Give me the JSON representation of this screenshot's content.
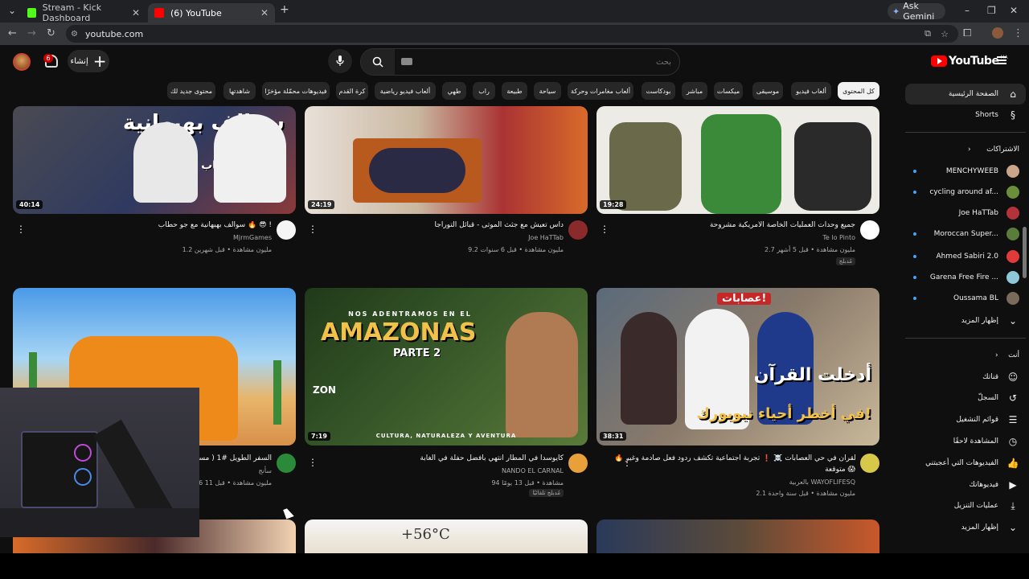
{
  "browser": {
    "tabs": [
      {
        "label": "Stream - Kick Dashboard",
        "favicon_color": "#53fc18"
      },
      {
        "label": "(6) YouTube",
        "favicon_color": "#ff0000"
      }
    ],
    "gemini_label": "Ask Gemini",
    "url": "youtube.com"
  },
  "header": {
    "notification_count": "6",
    "create_label": "إنشاء",
    "search_placeholder": "بحث",
    "logo_text": "YouTube",
    "logo_region": "MA"
  },
  "chips": [
    {
      "label": "كل المحتوى",
      "active": true
    },
    {
      "label": "ألعاب فيديو"
    },
    {
      "label": "موسيقى"
    },
    {
      "label": "ميكسات"
    },
    {
      "label": "مباشر"
    },
    {
      "label": "بودكاست"
    },
    {
      "label": "ألعاب مغامرات وحركة"
    },
    {
      "label": "سياحة"
    },
    {
      "label": "طبيعة"
    },
    {
      "label": "راب"
    },
    {
      "label": "طهي"
    },
    {
      "label": "ألعاب فيديو رياضية"
    },
    {
      "label": "كرة القدم"
    },
    {
      "label": "فيديوهات محمّلة مؤخرًا"
    },
    {
      "label": "شاهدتها"
    },
    {
      "label": "محتوى جديد لك"
    }
  ],
  "sidebar": {
    "home": "الصفحة الرئيسية",
    "shorts": "Shorts",
    "subscriptions_header": "الاشتراكات",
    "subscriptions": [
      {
        "label": "MENCHYWEEB",
        "color": "#c9a58a"
      },
      {
        "label": "cycling around af...",
        "color": "#6b8e3a"
      },
      {
        "label": "Joe HaTTab",
        "color": "#b4323a"
      },
      {
        "label": "Moroccan Super...",
        "color": "#5a7d3a"
      },
      {
        "label": "Ahmed Sabiri 2.0",
        "color": "#e03a3a"
      },
      {
        "label": "Garena Free Fire ...",
        "color": "#8ec7d8"
      },
      {
        "label": "Oussama BL",
        "color": "#7a6a5a"
      }
    ],
    "show_more": "إظهار المزيد",
    "you_header": "أنت",
    "you_items": [
      {
        "label": "قناتك",
        "icon": "person-icon"
      },
      {
        "label": "السجلّ",
        "icon": "history-icon"
      },
      {
        "label": "قوائم التشغيل",
        "icon": "playlist-icon"
      },
      {
        "label": "المشاهدة لاحقًا",
        "icon": "clock-icon"
      },
      {
        "label": "الفيديوهات التي أعجبتني",
        "icon": "thumbs-up-icon"
      },
      {
        "label": "فيديوهاتك",
        "icon": "video-icon"
      },
      {
        "label": "عمليات التنزيل",
        "icon": "download-icon"
      }
    ],
    "show_more_2": "إظهار المزيد"
  },
  "videos": [
    {
      "duration": "40:14",
      "title": "سوالف بهبهانية مع جو حطاب 🔥 😎 !",
      "channel": "MjrmGames",
      "meta": "1.2 مليون مشاهدة • قبل شهرين",
      "thumb_text": "سوالف بهبهانية",
      "thumb_sub": "مع جو حطاب"
    },
    {
      "duration": "24:19",
      "title": "داس تعيش مع جثث الموتى - قبائل التوراجا",
      "channel": "Joe HaTTab",
      "meta": "9.2 مليون مشاهدة • قبل 6 سنوات"
    },
    {
      "duration": "19:28",
      "title": "جميع وحدات العمليات الخاصة الأمريكية مشروحة",
      "channel": "Te lo Pinto",
      "meta": "2.7 مليون مشاهدة • قبل 5 أشهر",
      "tag": "مُدبلج"
    },
    {
      "duration": "",
      "title": "السفر الطويل #1 ( مسكت",
      "channel": "سأنج",
      "meta": "1.6 مليون مشاهدة • قبل 11"
    },
    {
      "duration": "7:19",
      "title": "كايوسدا في المطار انتهي بأفضل حفلة في الغابة",
      "channel": "NANDO EL CARNAL",
      "meta": "94 مشاهدة • قبل 13 يومًا",
      "tag": "مُدبلج تلقائيًا",
      "thumb_text": "AMAZONAS",
      "thumb_pre": "NOS ADENTRAMOS EN EL",
      "thumb_part": "PARTE 2",
      "thumb_bottom": "CULTURA, NATURALEZA Y AVENTURA",
      "thumb_logo": "ZON"
    },
    {
      "duration": "38:31",
      "title": "🔥 القرآن في حي العصابات ☠️ ❗ تجربة اجتماعية تكشف ردود فعل صادمة وغير",
      "title2": "متوقعة 😱",
      "channel": "WAYOFLIFESQ",
      "channel_sub": "بالعربية",
      "meta": "2.1 مليون مشاهدة • قبل سنة واحدة",
      "thumb_text": "أدخلت القرآن",
      "thumb_sub": "في أخطر أحياء نيويورك!",
      "thumb_top": "عصابات!"
    },
    {
      "duration": "",
      "title": "",
      "channel": "",
      "meta": ""
    },
    {
      "duration": "",
      "title": "",
      "channel": "",
      "meta": "",
      "thumb_text": "+56°C"
    },
    {
      "duration": "",
      "title": "",
      "channel": "",
      "meta": ""
    }
  ]
}
